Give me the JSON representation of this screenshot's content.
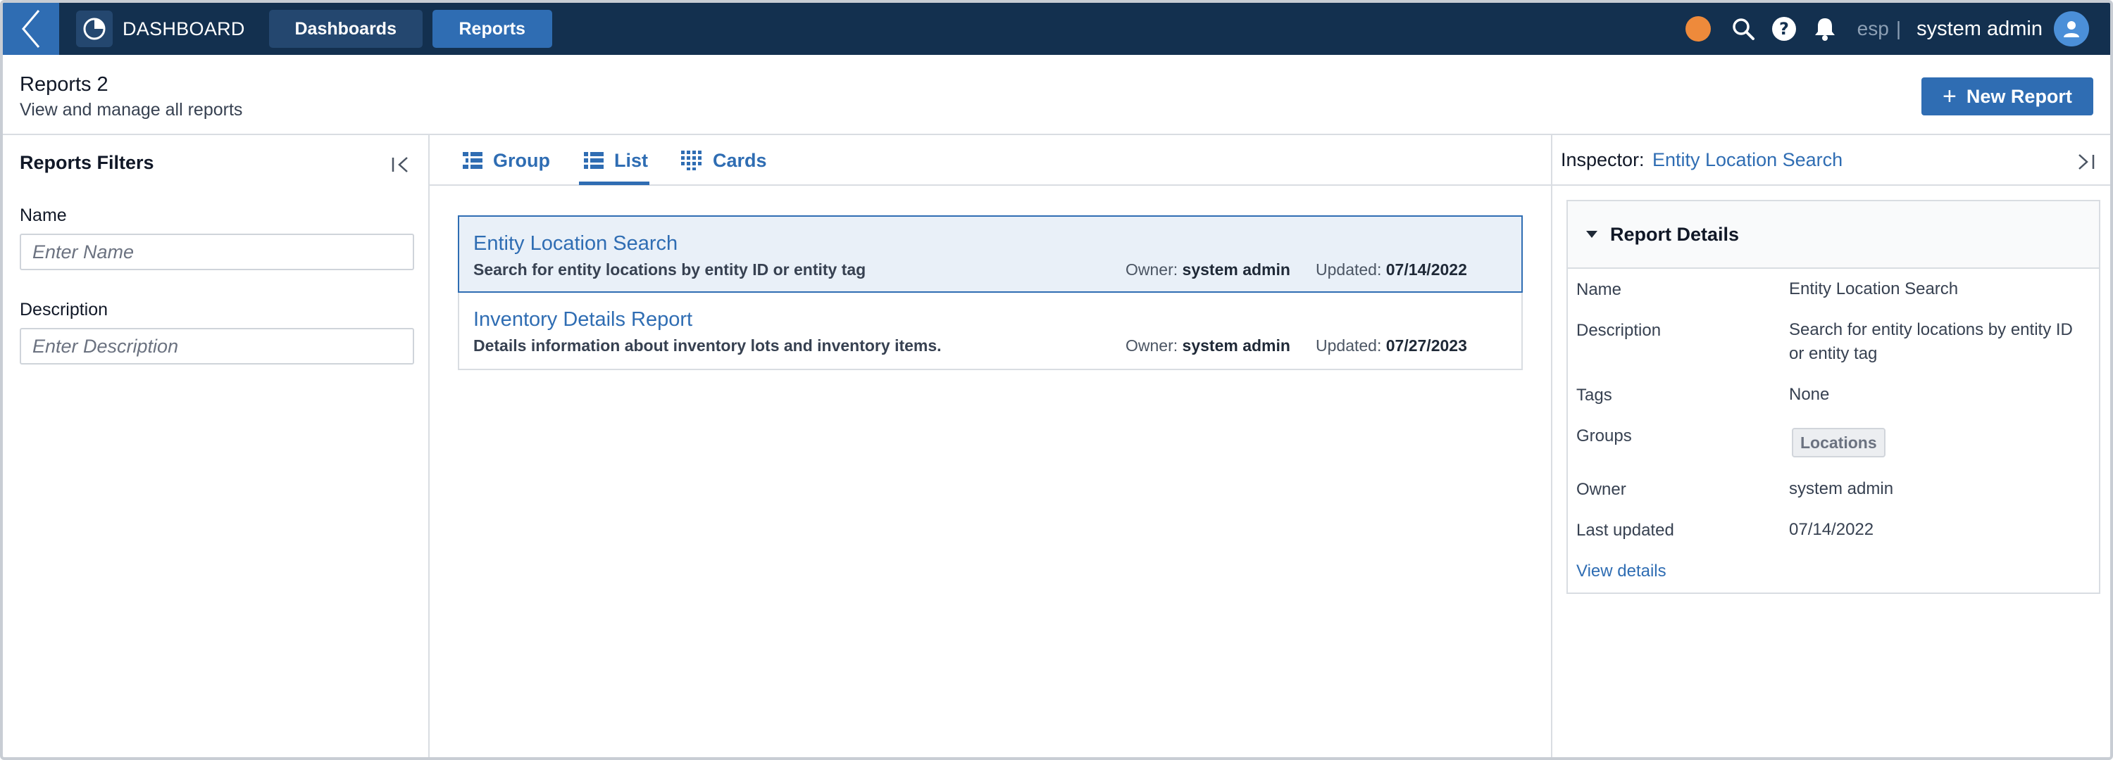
{
  "topbar": {
    "app_title": "DASHBOARD",
    "nav": [
      {
        "label": "Dashboards",
        "active": false
      },
      {
        "label": "Reports",
        "active": true
      }
    ],
    "status_color": "#ee8a3b",
    "icons": [
      "back-chevron-icon",
      "pie-chart-logo-icon",
      "search-icon",
      "help-icon",
      "bell-icon",
      "user-avatar-icon"
    ],
    "language": "esp",
    "separator": "|",
    "username": "system admin"
  },
  "page": {
    "title": "Reports",
    "count": "2",
    "subtitle": "View and manage all reports",
    "new_button": "New Report",
    "new_button_icon": "plus-icon"
  },
  "filters": {
    "title": "Reports Filters",
    "name_label": "Name",
    "name_placeholder": "Enter Name",
    "description_label": "Description",
    "description_placeholder": "Enter Description"
  },
  "views": {
    "tabs": [
      {
        "label": "Group",
        "icon": "group-list-icon",
        "active": false
      },
      {
        "label": "List",
        "icon": "list-icon",
        "active": true
      },
      {
        "label": "Cards",
        "icon": "cards-grid-icon",
        "active": false
      }
    ]
  },
  "reports": [
    {
      "name": "Entity Location Search",
      "description": "Search for entity locations by entity ID or entity tag",
      "owner_label": "Owner:",
      "owner": "system admin",
      "updated_label": "Updated:",
      "updated": "07/14/2022",
      "selected": true
    },
    {
      "name": "Inventory Details Report",
      "description": "Details information about inventory lots and inventory items.",
      "owner_label": "Owner:",
      "owner": "system admin",
      "updated_label": "Updated:",
      "updated": "07/27/2023",
      "selected": false
    }
  ],
  "inspector": {
    "label": "Inspector:",
    "target": "Entity Location Search",
    "section_title": "Report Details",
    "fields": {
      "name_key": "Name",
      "name_val": "Entity Location Search",
      "description_key": "Description",
      "description_val": "Search for entity locations by entity ID or entity tag",
      "tags_key": "Tags",
      "tags_val": "None",
      "groups_key": "Groups",
      "groups_val": "Locations",
      "owner_key": "Owner",
      "owner_val": "system admin",
      "updated_key": "Last updated",
      "updated_val": "07/14/2022"
    },
    "view_details": "View details"
  },
  "colors": {
    "topbar": "#13304f",
    "accent": "#2f6db3",
    "selected_row": "#e9f0f8"
  }
}
